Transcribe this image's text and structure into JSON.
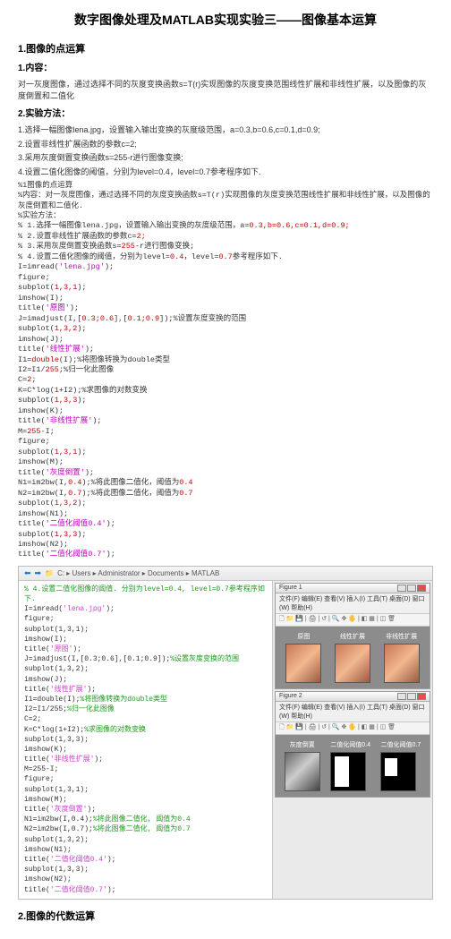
{
  "title": "数字图像处理及MATLAB实现实验三——图像基本运算",
  "s1": {
    "heading": "1.图像的点运算",
    "sub1": "1.内容：",
    "para1": "对一灰度图像，通过选择不同的灰度变换函数s=T(r)实现图像的灰度变换范围线性扩展和非线性扩展，以及图像的灰度倒置和二值化",
    "sub2": "2.实验方法：",
    "steps": [
      "1.选择一幅图像lena.jpg，设置输入输出变换的灰度级范围，a=0.3,b=0.6,c=0.1,d=0.9;",
      "2.设置非线性扩展函数的参数c=2;",
      "3.采用灰度倒置变换函数s=255-r进行图像变换;",
      "4.设置二值化图像的阈值，分别为level=0.4，level=0.7参考程序如下."
    ]
  },
  "code": {
    "l01": "%1图像的点运算",
    "l02": "%内容：对一灰度图像，通过选择不同的灰度变换函数s=T(r)实现图像的灰度变换范围线性扩展和非线性扩展，以及图像的灰度倒置和二值化.",
    "l03": "%实验方法：",
    "l04a": "% 1.选择一幅图像lena.jpg，设置输入输出变换的灰度级范围，a=",
    "l04_nums": "0.3,b=0.6,c=0.1,d=0.9;",
    "l05a": "% 2.设置非线性扩展函数的参数c=",
    "l05_num": "2;",
    "l06a": "% 3.采用灰度倒置变换函数s=",
    "l06_mid": "255",
    "l06b": "-r进行图像变换;",
    "l07a": "% 4.设置二值化图像的阈值，分别为level=",
    "l07_n1": "0.4",
    "l07_mid": "，level=",
    "l07_n2": "0.7",
    "l07_end": "参考程序如下.",
    "l08a": "I=imread(",
    "l08_str": "'lena.jpg'",
    "l08b": ");",
    "l09": "figure;",
    "l10a": "subplot(",
    "l10_n": "1,3,1",
    "l10b": ");",
    "l11": "imshow(I);",
    "l12a": "title(",
    "l12_str": "'原图'",
    "l12b": ");",
    "l13a": "J=imadjust(I,[",
    "l13_n1": "0.3;0.6",
    "l13_mid": "],[",
    "l13_n2": "0.1;0.9",
    "l13_end": "]);%设置灰度变换的范围",
    "l14a": "subplot(",
    "l14_n": "1,3,2",
    "l14b": ");",
    "l15": "imshow(J);",
    "l16a": "title(",
    "l16_str": "'线性扩展'",
    "l16b": ");",
    "l17a": "I1=",
    "l17_fn": "double",
    "l17b": "(I);%将图像转换为double类型",
    "l18a": "I2=I1/",
    "l18_n": "255",
    "l18b": ";%归一化此图像",
    "l19a": "C=",
    "l19_n": "2",
    "l19b": ";",
    "l20a": "K=C*log(",
    "l20_n": "1",
    "l20b": "+I2);%求图像的对数变换",
    "l21a": "subplot(",
    "l21_n": "1,3,3",
    "l21b": ");",
    "l22": "imshow(K);",
    "l23a": "title(",
    "l23_str": "'非线性扩展'",
    "l23b": ");",
    "l24a": "M=",
    "l24_n": "255",
    "l24b": "-I;",
    "l25": "figure;",
    "l26a": "subplot(",
    "l26_n": "1,3,1",
    "l26b": ");",
    "l27": "imshow(M);",
    "l28a": "title(",
    "l28_str": "'灰度倒置'",
    "l28b": ");",
    "l29a": "N1=im2bw(I,",
    "l29_n": "0.4",
    "l29b": ");%将此图像二值化，阈值为",
    "l29_n2": "0.4",
    "l30a": "N2=im2bw(I,",
    "l30_n": "0.7",
    "l30b": ");%将此图像二值化，阈值为",
    "l30_n2": "0.7",
    "l31a": "subplot(",
    "l31_n": "1,3,2",
    "l31b": ");",
    "l32": "imshow(N1);",
    "l33a": "title(",
    "l33_str": "'二值化阈值0.4'",
    "l33b": ");",
    "l34a": "subplot(",
    "l34_n": "1,3,3",
    "l34b": ");",
    "l35": "imshow(N2);",
    "l36a": "title(",
    "l36_str": "'二值化阈值0.7'",
    "l36b": ");"
  },
  "ide": {
    "path": "C: ▸ Users ▸ Administrator ▸ Documents ▸ MATLAB",
    "editor": [
      {
        "cls": "g",
        "t": "% 4.设置二值化图像的阈值. 分别为level=0.4, level=0.7参考程序如下."
      },
      {
        "cls": "",
        "t": "I=imread('lena.jpg');"
      },
      {
        "cls": "",
        "t": "figure;"
      },
      {
        "cls": "",
        "t": "subplot(1,3,1);"
      },
      {
        "cls": "",
        "t": "imshow(I);"
      },
      {
        "cls": "",
        "t": "title('原图');"
      },
      {
        "cls": "",
        "t": "J=imadjust(I,[0.3;0.6],[0.1;0.9]);%设置灰度变换的范围"
      },
      {
        "cls": "",
        "t": "subplot(1,3,2);"
      },
      {
        "cls": "",
        "t": "imshow(J);"
      },
      {
        "cls": "",
        "t": "title('线性扩展');"
      },
      {
        "cls": "",
        "t": "I1=double(I);%将图像转换为double类型"
      },
      {
        "cls": "",
        "t": "I2=I1/255;%归一化此图像"
      },
      {
        "cls": "",
        "t": "C=2;"
      },
      {
        "cls": "",
        "t": "K=C*log(1+I2);%求图像的对数变换"
      },
      {
        "cls": "",
        "t": "subplot(1,3,3);"
      },
      {
        "cls": "",
        "t": "imshow(K);"
      },
      {
        "cls": "",
        "t": "title('非线性扩展');"
      },
      {
        "cls": "",
        "t": "M=255-I;"
      },
      {
        "cls": "",
        "t": "figure;"
      },
      {
        "cls": "",
        "t": "subplot(1,3,1);"
      },
      {
        "cls": "",
        "t": "imshow(M);"
      },
      {
        "cls": "",
        "t": "title('灰度倒置');"
      },
      {
        "cls": "",
        "t": "N1=im2bw(I,0.4);%将此图像二值化, 阈值为0.4"
      },
      {
        "cls": "",
        "t": "N2=im2bw(I,0.7);%将此图像二值化, 阈值为0.7"
      },
      {
        "cls": "",
        "t": "subplot(1,3,2);"
      },
      {
        "cls": "",
        "t": "imshow(N1);"
      },
      {
        "cls": "",
        "t": "title('二值化阈值0.4');"
      },
      {
        "cls": "",
        "t": "subplot(1,3,3);"
      },
      {
        "cls": "",
        "t": "imshow(N2);"
      },
      {
        "cls": "",
        "t": "title('二值化阈值0.7');"
      }
    ],
    "fig1": {
      "title": "Figure 1",
      "menu": "文件(F) 编辑(E) 查看(V) 插入(I) 工具(T) 桌面(D) 窗口(W) 帮助(H)",
      "icons": "🗋 📁 💾 | 🖨 | ↺ | 🔍 ✥ 🖐 | ◧ ▦ | ◫ 🗑",
      "captions": [
        "原图",
        "线性扩展",
        "非线性扩展"
      ]
    },
    "fig2": {
      "title": "Figure 2",
      "menu": "文件(F) 编辑(E) 查看(V) 插入(I) 工具(T) 桌面(D) 窗口(W) 帮助(H)",
      "icons": "🗋 📁 💾 | 🖨 | ↺ | 🔍 ✥ 🖐 | ◧ ▦ | ◫ 🗑",
      "captions": [
        "灰度倒置",
        "二值化阈值0.4",
        "二值化阈值0.7"
      ]
    }
  },
  "s2": {
    "heading": "2.图像的代数运算"
  }
}
